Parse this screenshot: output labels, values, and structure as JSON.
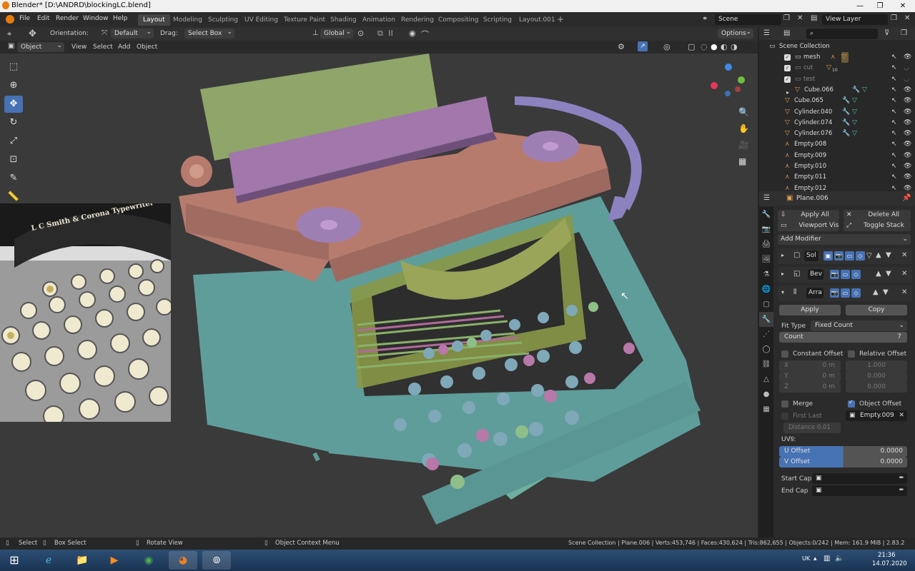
{
  "window": {
    "title": "Blender* [D:\\ANDRD\\blockingLC.blend]",
    "controls": [
      "—",
      "❐",
      "✕"
    ]
  },
  "menu": [
    "File",
    "Edit",
    "Render",
    "Window",
    "Help"
  ],
  "workspaces": [
    "Layout",
    "Modeling",
    "Sculpting",
    "UV Editing",
    "Texture Paint",
    "Shading",
    "Animation",
    "Rendering",
    "Compositing",
    "Scripting",
    "Layout.001"
  ],
  "active_workspace": "Layout",
  "scene": {
    "label": "Scene",
    "view_layer": "View Layer"
  },
  "tool_header": {
    "orientation_label": "Orientation:",
    "orientation_value": "Default",
    "drag_label": "Drag:",
    "drag_value": "Select Box",
    "transform_orientation": "Global",
    "options": "Options"
  },
  "viewport_header": {
    "mode": "Object Mode",
    "menus": [
      "View",
      "Select",
      "Add",
      "Object"
    ]
  },
  "reference_image_text": "L C Smith & Corona Typewriter",
  "outliner": {
    "root": "Scene Collection",
    "rows": [
      {
        "name": "mesh",
        "indent": 1,
        "checked": true,
        "dim": false
      },
      {
        "name": "cut",
        "indent": 1,
        "checked": true,
        "dim": true,
        "count": "10"
      },
      {
        "name": "test",
        "indent": 1,
        "checked": true,
        "dim": true
      },
      {
        "name": "Cube.066",
        "indent": 2,
        "checked": false,
        "dim": false
      },
      {
        "name": "Cube.065",
        "indent": 1,
        "checked": false,
        "dim": false
      },
      {
        "name": "Cylinder.040",
        "indent": 1,
        "checked": false,
        "dim": false
      },
      {
        "name": "Cylinder.074",
        "indent": 1,
        "checked": false,
        "dim": false
      },
      {
        "name": "Cylinder.076",
        "indent": 1,
        "checked": false,
        "dim": false
      },
      {
        "name": "Empty.008",
        "indent": 1,
        "checked": false,
        "dim": false
      },
      {
        "name": "Empty.009",
        "indent": 1,
        "checked": false,
        "dim": false
      },
      {
        "name": "Empty.010",
        "indent": 1,
        "checked": false,
        "dim": false
      },
      {
        "name": "Empty.011",
        "indent": 1,
        "checked": false,
        "dim": false
      },
      {
        "name": "Empty.012",
        "indent": 1,
        "checked": false,
        "dim": false
      }
    ]
  },
  "properties": {
    "object": "Plane.006",
    "apply_all": "Apply All",
    "delete_all": "Delete All",
    "viewport_vis": "Viewport Vis",
    "toggle_stack": "Toggle Stack",
    "add_modifier": "Add Modifier",
    "modifiers": [
      "Sol",
      "Bev",
      "Arra"
    ],
    "apply": "Apply",
    "copy": "Copy",
    "fit_type_label": "Fit Type",
    "fit_type_value": "Fixed Count",
    "count_label": "Count",
    "count_value": "7",
    "constant_offset": "Constant Offset",
    "relative_offset": "Relative Offset",
    "const_axes": [
      {
        "axis": "X",
        "value": "0 m"
      },
      {
        "axis": "Y",
        "value": "0 m"
      },
      {
        "axis": "Z",
        "value": "0 m"
      }
    ],
    "rel_values": [
      "1.000",
      "0.000",
      "0.000"
    ],
    "merge": "Merge",
    "object_offset": "Object Offset",
    "first_last": "First Last",
    "distance": "Distance 0.01 m",
    "offset_object": "Empty.009",
    "uvs_label": "UVs:",
    "u_offset_label": "U Offset",
    "u_offset_value": "0.0000",
    "v_offset_label": "V Offset",
    "v_offset_value": "0.0000",
    "start_cap": "Start Cap",
    "end_cap": "End Cap"
  },
  "statusbar": {
    "select": "Select",
    "box_select": "Box Select",
    "rotate_view": "Rotate View",
    "context_menu": "Object Context Menu",
    "stats": "Scene Collection | Plane.006 | Verts:453,746 | Faces:430,624 | Tris:862,655 | Objects:0/242 | Mem: 161.9 MiB | 2.83.2"
  },
  "taskbar": {
    "lang": "UK",
    "time": "21:36",
    "date": "14.07.2020"
  }
}
